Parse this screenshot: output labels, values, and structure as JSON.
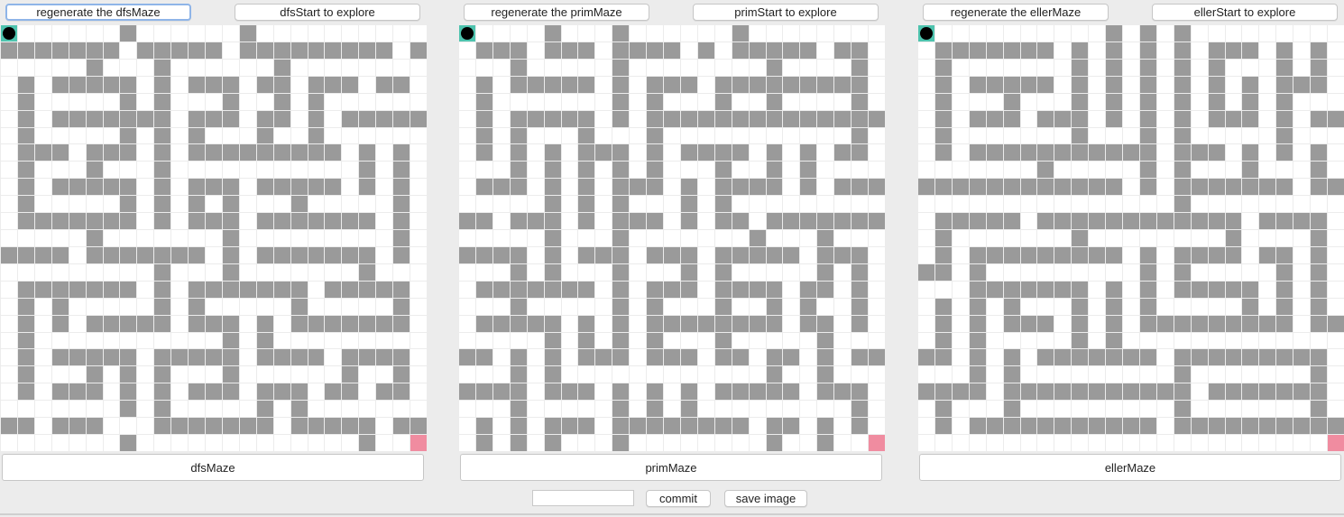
{
  "panels": [
    {
      "id": "dfs",
      "regen_label": "regenerate the dfsMaze",
      "start_label": "dfsStart to explore",
      "name_label": "dfsMaze",
      "grid": [
        "0000000100000010000000000",
        "1111111011111011111111101",
        "0000010001000000100000000",
        "0101111101011101101110110",
        "0100000101000100101000000",
        "0101111111011101101011111",
        "0100000101010001001000000",
        "0111011101011111111101010",
        "0100010001000000000001010",
        "0101111101011101111101010",
        "0100000101010100010000010",
        "0111111101011101111111010",
        "0000010000000100000000010",
        "1111011111110101111111010",
        "0000000001000100000001000",
        "0111111101011111110111110",
        "0101000001010000010000010",
        "0101011111011101011111110",
        "0100000000000101000000000",
        "0101111101111101111011110",
        "0100010101000100000010010",
        "0101110101011101110110110",
        "0000000101000001010000000",
        "1101110001111111011111011",
        "0000000100000000000001000"
      ]
    },
    {
      "id": "prim",
      "regen_label": "regenerate the primMaze",
      "start_label": "primStart to explore",
      "name_label": "primMaze",
      "grid": [
        "0000010001000000100000000",
        "0111011101111010111110110",
        "0001000001000000001000010",
        "0101111101011101111111110",
        "0100000001010001001000010",
        "0101111101011111111111111",
        "0101000100010000000000010",
        "0101010111010111101010110",
        "0001010101010001001010000",
        "0111010101110101111010111",
        "0000010101000101000000000",
        "1101110101110101101111111",
        "0000010001000000010001000",
        "1111010111011101111101110",
        "0001010001000101000001010",
        "0111111101011101111011010",
        "0001000001010001001010010",
        "0111110101011111111011010",
        "0000010101010001000001000",
        "1101010111011101101101011",
        "0001010000000000001001000",
        "1111011101010101111101110",
        "0001000001010100000000010",
        "0101011101111111101101010",
        "0101010001000000001001000"
      ]
    },
    {
      "id": "eller",
      "regen_label": "regenerate the ellerMaze",
      "start_label": "ellerStart to explore",
      "name_label": "ellerMaze",
      "grid": [
        "0000000000010101000000000",
        "0111111101010101011101010",
        "0100000001010101010001010",
        "0101111101010101010101110",
        "0100010001010101010101000",
        "0101110111010101011101011",
        "0100000001000101000001000",
        "0101111111111101110101010",
        "0000000100000101000100010",
        "1111111111110101111111011",
        "0000000000000001000000000",
        "0111110111111111111011110",
        "0100000001000000001000010",
        "0101111111110101111011010",
        "1101000000000101000001010",
        "0001111111010101111101010",
        "0101010001010100000101010",
        "0101011101010111111111011",
        "0101000001010000000000000",
        "1101010111111101111111110",
        "0001010000000001000000010",
        "1111011111111111011111110",
        "0100010000000001000000010",
        "0101111111111101111111111",
        "0000000000000000000000000"
      ]
    }
  ],
  "bottom": {
    "input_value": "",
    "commit_label": "commit",
    "save_label": "save image"
  },
  "colors": {
    "wall": "#9a9a9a",
    "path": "#ffffff",
    "start": "#4ec3ae",
    "end": "#f08ca0",
    "explorer": "#000000"
  }
}
